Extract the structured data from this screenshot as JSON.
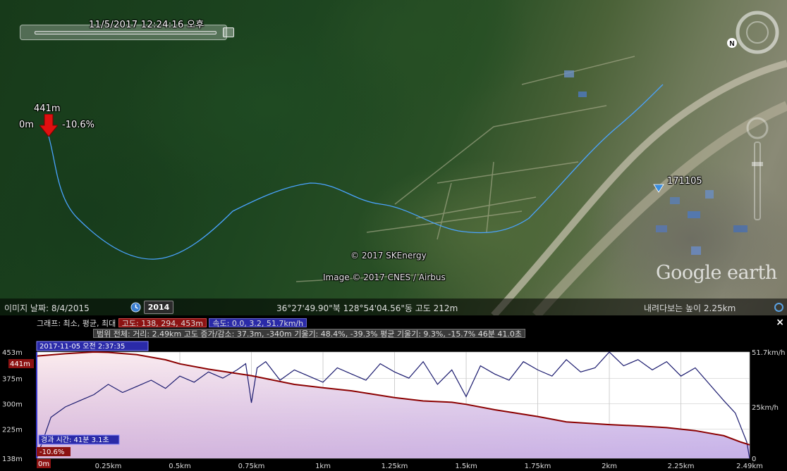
{
  "map": {
    "timestamp": "11/5/2017  12:24:16 오후",
    "start_altitude": "441m",
    "start_distance": "0m",
    "start_slope": "-10.6%",
    "placemark": "171105",
    "copyright_lines": [
      "© 2017 SKEnergy",
      "Image © 2017 CNES / Airbus"
    ],
    "logo_text": "Google earth"
  },
  "status": {
    "imagery_date": "이미지 날짜: 8/4/2015",
    "year": "2014",
    "coordinates": "36°27'49.90\"북 128°54'04.56\"동 고도   212m",
    "eye_altitude": "내려다보는 높이     2.25km"
  },
  "elevation_panel": {
    "graph_label": "그래프: 최소, 평균, 최대",
    "altitude_stats": "고도: 138, 294, 453m",
    "speed_stats": "속도: 0.0, 3.2, 51.7km/h",
    "range_row": "범위 전체: 거리: 2.49km 고도 증가/감소: 37.3m, -340m 기울기: 48.4%, -39.3% 평균 기울기: 9.3%, -15.7% 46분 41.0초",
    "close_label": "×",
    "cursor_time": "2017-11-05 오전 2:37:35",
    "cursor_altitude": "441m",
    "cursor_duration": "경과 시간: 41분 3.1초",
    "cursor_slope": "-10.6%",
    "cursor_distance": "0m"
  },
  "chart_data": {
    "type": "line",
    "x_unit": "km",
    "xlim": [
      0,
      2.49
    ],
    "x_ticks": [
      "0m",
      "0.25km",
      "0.5km",
      "0.75km",
      "1km",
      "1.25km",
      "1.5km",
      "1.75km",
      "2km",
      "2.25km",
      "2.49km"
    ],
    "y_left_ticks": [
      "453m",
      "375m",
      "300m",
      "225m",
      "138m"
    ],
    "y_left_lim": [
      138,
      453
    ],
    "y_right_ticks": [
      "51.7km/h",
      "25km/h",
      "0"
    ],
    "y_right_lim": [
      0,
      51.7
    ],
    "series": [
      {
        "name": "고도",
        "color": "#8b0000",
        "x": [
          0,
          0.1,
          0.2,
          0.25,
          0.35,
          0.45,
          0.5,
          0.6,
          0.75,
          0.9,
          1.0,
          1.1,
          1.25,
          1.35,
          1.45,
          1.5,
          1.6,
          1.75,
          1.85,
          2.0,
          2.1,
          2.2,
          2.3,
          2.4,
          2.46,
          2.49
        ],
        "values": [
          441,
          448,
          453,
          452,
          445,
          430,
          418,
          402,
          383,
          357,
          347,
          338,
          318,
          308,
          304,
          298,
          282,
          262,
          246,
          238,
          234,
          229,
          220,
          205,
          186,
          178
        ]
      },
      {
        "name": "속도",
        "color": "#1a1a6e",
        "x": [
          0,
          0.02,
          0.05,
          0.1,
          0.15,
          0.2,
          0.25,
          0.3,
          0.35,
          0.4,
          0.45,
          0.5,
          0.55,
          0.6,
          0.65,
          0.7,
          0.73,
          0.75,
          0.77,
          0.8,
          0.85,
          0.9,
          0.95,
          1.0,
          1.05,
          1.1,
          1.15,
          1.2,
          1.25,
          1.3,
          1.35,
          1.4,
          1.45,
          1.5,
          1.55,
          1.6,
          1.65,
          1.7,
          1.75,
          1.8,
          1.85,
          1.9,
          1.95,
          2.0,
          2.05,
          2.1,
          2.15,
          2.2,
          2.25,
          2.3,
          2.35,
          2.4,
          2.44,
          2.46,
          2.48,
          2.49
        ],
        "values": [
          0,
          8,
          20,
          25,
          28,
          31,
          36,
          32,
          35,
          38,
          34,
          40,
          37,
          42,
          39,
          43,
          46,
          27,
          44,
          47,
          38,
          43,
          40,
          37,
          44,
          41,
          38,
          46,
          42,
          39,
          47,
          36,
          43,
          30,
          45,
          41,
          38,
          47,
          43,
          40,
          48,
          42,
          44,
          51.7,
          45,
          48,
          43,
          47,
          40,
          44,
          36,
          28,
          22,
          15,
          8,
          0
        ]
      }
    ]
  }
}
